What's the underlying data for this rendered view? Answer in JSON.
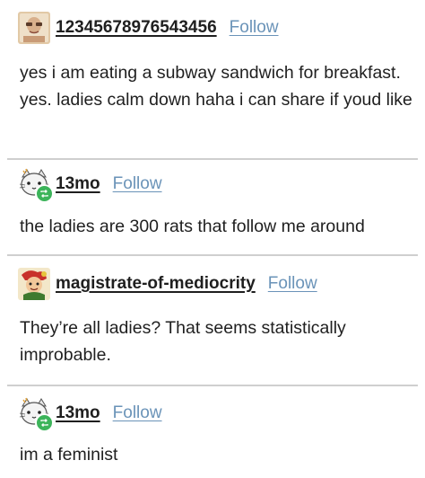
{
  "posts": [
    {
      "username": "12345678976543456",
      "follow_label": "Follow",
      "text": "yes i am eating a subway sandwich for breakfast. yes. ladies calm down haha i can share if youd like",
      "avatar_icon": "portrait-avatar-icon"
    },
    {
      "username": "13mo",
      "follow_label": "Follow",
      "text": "the ladies are 300 rats that follow me around",
      "avatar_icon": "cat-avatar-icon"
    },
    {
      "username": "magistrate-of-mediocrity",
      "follow_label": "Follow",
      "text": "They’re all ladies? That seems statistically improbable.",
      "avatar_icon": "red-character-avatar-icon"
    },
    {
      "username": "13mo",
      "follow_label": "Follow",
      "text": "im a feminist",
      "avatar_icon": "cat-avatar-icon"
    }
  ],
  "colors": {
    "follow_link": "#6a93b8",
    "reblog_badge": "#3cb45a",
    "divider": "#cfcfcf",
    "text": "#1f1f1f"
  }
}
